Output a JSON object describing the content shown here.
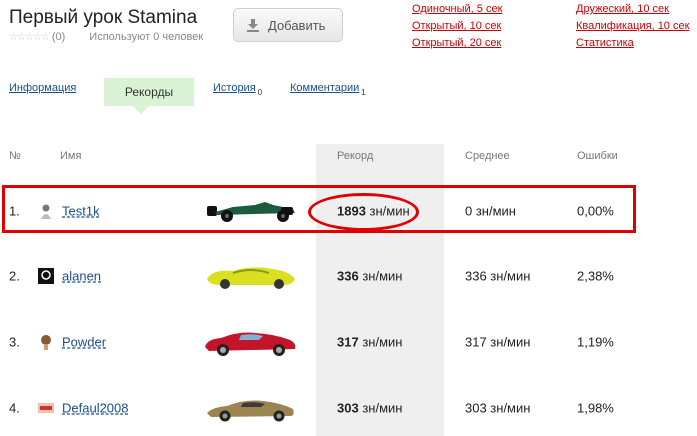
{
  "header": {
    "title": "Первый урок Stamina",
    "rating_count": "(0)",
    "stars": "☆☆☆☆☆",
    "users": "Используют 0 человек",
    "add_button": "Добавить"
  },
  "modes": {
    "col1": [
      "Одиночный, 5 сек",
      "Открытый, 10 сек",
      "Открытый, 20 сек"
    ],
    "col2": [
      "Дружеский, 10 сек",
      "Квалификация, 10 сек",
      "Статистика"
    ]
  },
  "tabs": {
    "info": "Информация",
    "records": "Рекорды",
    "history": "История",
    "history_count": "0",
    "comments": "Комментарии",
    "comments_count": "1"
  },
  "table": {
    "columns": {
      "num": "№",
      "name": "Имя",
      "record": "Рекорд",
      "avg": "Среднее",
      "errors": "Ошибки"
    },
    "rows": [
      {
        "rank": "1.",
        "name": "Test1k",
        "record_value": "1893",
        "record_unit": "зн/мин",
        "avg": "0 зн/мин",
        "errors": "0,00%"
      },
      {
        "rank": "2.",
        "name": "alanen",
        "record_value": "336",
        "record_unit": "зн/мин",
        "avg": "336 зн/мин",
        "errors": "2,38%"
      },
      {
        "rank": "3.",
        "name": "Powder",
        "record_value": "317",
        "record_unit": "зн/мин",
        "avg": "317 зн/мин",
        "errors": "1,19%"
      },
      {
        "rank": "4.",
        "name": "Defaul2008",
        "record_value": "303",
        "record_unit": "зн/мин",
        "avg": "303 зн/мин",
        "errors": "1,98%"
      }
    ]
  },
  "colors": {
    "link": "#1a4f8a",
    "mode_link": "#cc0000",
    "active_tab": "#d9f3d4",
    "highlight": "#e00000",
    "record_column": "#efefef"
  },
  "icons": {
    "add": "download-icon",
    "row1_avatar": "avatar-icon",
    "row2_avatar": "avatar-icon",
    "row3_avatar": "avatar-icon",
    "row4_avatar": "avatar-icon",
    "row1_car": "formula-car-icon",
    "row2_car": "concept-car-icon",
    "row3_car": "sports-car-icon",
    "row4_car": "supercar-icon"
  }
}
